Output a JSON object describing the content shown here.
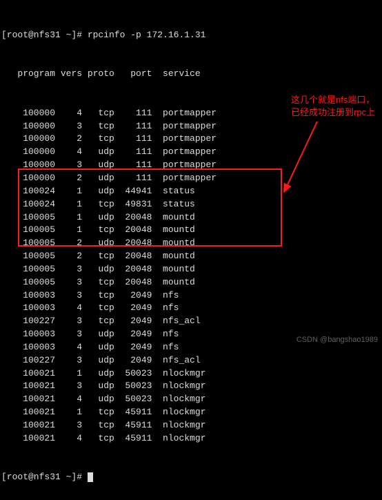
{
  "prompt1": {
    "prefix": "[root@nfs31 ~]# ",
    "command": "rpcinfo -p 172.16.1.31"
  },
  "header": {
    "program": "program",
    "vers": "vers",
    "proto": "proto",
    "port": "port",
    "service": "service"
  },
  "rows": [
    {
      "program": "100000",
      "vers": "4",
      "proto": "tcp",
      "port": "111",
      "service": "portmapper"
    },
    {
      "program": "100000",
      "vers": "3",
      "proto": "tcp",
      "port": "111",
      "service": "portmapper"
    },
    {
      "program": "100000",
      "vers": "2",
      "proto": "tcp",
      "port": "111",
      "service": "portmapper"
    },
    {
      "program": "100000",
      "vers": "4",
      "proto": "udp",
      "port": "111",
      "service": "portmapper"
    },
    {
      "program": "100000",
      "vers": "3",
      "proto": "udp",
      "port": "111",
      "service": "portmapper"
    },
    {
      "program": "100000",
      "vers": "2",
      "proto": "udp",
      "port": "111",
      "service": "portmapper"
    },
    {
      "program": "100024",
      "vers": "1",
      "proto": "udp",
      "port": "44941",
      "service": "status"
    },
    {
      "program": "100024",
      "vers": "1",
      "proto": "tcp",
      "port": "49831",
      "service": "status"
    },
    {
      "program": "100005",
      "vers": "1",
      "proto": "udp",
      "port": "20048",
      "service": "mountd"
    },
    {
      "program": "100005",
      "vers": "1",
      "proto": "tcp",
      "port": "20048",
      "service": "mountd"
    },
    {
      "program": "100005",
      "vers": "2",
      "proto": "udp",
      "port": "20048",
      "service": "mountd"
    },
    {
      "program": "100005",
      "vers": "2",
      "proto": "tcp",
      "port": "20048",
      "service": "mountd"
    },
    {
      "program": "100005",
      "vers": "3",
      "proto": "udp",
      "port": "20048",
      "service": "mountd"
    },
    {
      "program": "100005",
      "vers": "3",
      "proto": "tcp",
      "port": "20048",
      "service": "mountd"
    },
    {
      "program": "100003",
      "vers": "3",
      "proto": "tcp",
      "port": "2049",
      "service": "nfs"
    },
    {
      "program": "100003",
      "vers": "4",
      "proto": "tcp",
      "port": "2049",
      "service": "nfs"
    },
    {
      "program": "100227",
      "vers": "3",
      "proto": "tcp",
      "port": "2049",
      "service": "nfs_acl"
    },
    {
      "program": "100003",
      "vers": "3",
      "proto": "udp",
      "port": "2049",
      "service": "nfs"
    },
    {
      "program": "100003",
      "vers": "4",
      "proto": "udp",
      "port": "2049",
      "service": "nfs"
    },
    {
      "program": "100227",
      "vers": "3",
      "proto": "udp",
      "port": "2049",
      "service": "nfs_acl"
    },
    {
      "program": "100021",
      "vers": "1",
      "proto": "udp",
      "port": "50023",
      "service": "nlockmgr"
    },
    {
      "program": "100021",
      "vers": "3",
      "proto": "udp",
      "port": "50023",
      "service": "nlockmgr"
    },
    {
      "program": "100021",
      "vers": "4",
      "proto": "udp",
      "port": "50023",
      "service": "nlockmgr"
    },
    {
      "program": "100021",
      "vers": "1",
      "proto": "tcp",
      "port": "45911",
      "service": "nlockmgr"
    },
    {
      "program": "100021",
      "vers": "3",
      "proto": "tcp",
      "port": "45911",
      "service": "nlockmgr"
    },
    {
      "program": "100021",
      "vers": "4",
      "proto": "tcp",
      "port": "45911",
      "service": "nlockmgr"
    }
  ],
  "prompt2": {
    "prefix": "[root@nfs31 ~]# "
  },
  "annotation": {
    "text": "这几个就是nfs端口，已经成功注册到rpc上"
  },
  "watermark": "CSDN @bangshao1989"
}
